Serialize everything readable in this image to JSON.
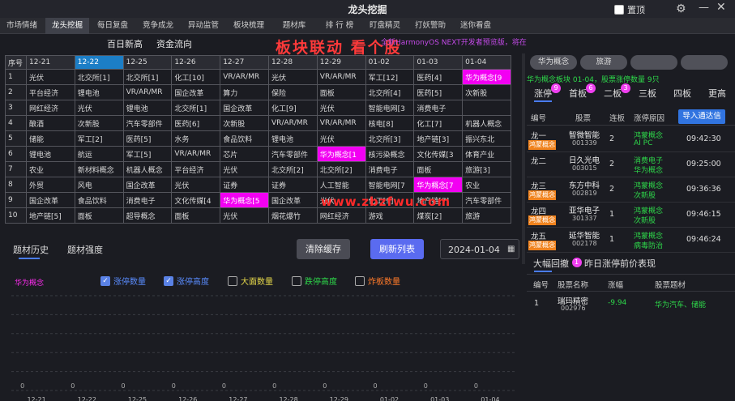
{
  "app": {
    "title": "龙头挖掘",
    "pin_label": "置顶"
  },
  "nav": [
    "市场情绪",
    "龙头挖掘",
    "每日复盘",
    "竞争成龙",
    "异动监管",
    "板块梳理",
    "题材库",
    "排 行 榜",
    "盯盘精灵",
    "打妖警助",
    "迷你看盘"
  ],
  "sub": {
    "tab1": "百日新高",
    "tab2": "资金流向"
  },
  "overlay": {
    "banner": "板块联动  看个股",
    "marquee": "全新HarmonyOS NEXT开发者预览版，将在今年第一季度面向所有开发者开放，鸿蒙异动",
    "watermark": "www.zbzfwu.com"
  },
  "grid": {
    "headers": [
      "序号",
      "12-21",
      "12-22",
      "12-25",
      "12-26",
      "12-27",
      "12-28",
      "12-29",
      "01-02",
      "01-03",
      "01-04"
    ],
    "selected_header": 2,
    "rows": [
      [
        "1",
        "光伏",
        "北交所[1]",
        "北交所[1]",
        "化工[10]",
        "VR/AR/MR",
        "光伏",
        "VR/AR/MR",
        "军工[12]",
        "医药[4]",
        "华为概念[9"
      ],
      [
        "2",
        "平台经济",
        "锂电池",
        "VR/AR/MR",
        "国企改革",
        "算力",
        "保险",
        "面板",
        "北交所[4]",
        "医药[5]",
        "次新股"
      ],
      [
        "3",
        "网红经济",
        "光伏",
        "锂电池",
        "北交所[1]",
        "国企改革",
        "化工[9]",
        "光伏",
        "智能电网[3",
        "消费电子"
      ],
      [
        "4",
        "酿酒",
        "次新股",
        "汽车零部件",
        "医药[6]",
        "次新股",
        "VR/AR/MR",
        "VR/AR/MR",
        "核电[8]",
        "化工[7]",
        "机器人概念"
      ],
      [
        "5",
        "储能",
        "军工[2]",
        "医药[5]",
        "水务",
        "食品饮料",
        "锂电池",
        "光伏",
        "北交所[3]",
        "地产链[3]",
        "振兴东北"
      ],
      [
        "6",
        "锂电池",
        "航运",
        "军工[5]",
        "VR/AR/MR",
        "芯片",
        "汽车零部件",
        "华为概念[1",
        "核污染概念",
        "文化传媒[3",
        "体育产业"
      ],
      [
        "7",
        "农业",
        "新材料概念",
        "机器人概念",
        "平台经济",
        "光伏",
        "北交所[2]",
        "北交所[2]",
        "消费电子",
        "面板",
        "旅游[3]",
        "氢能源"
      ],
      [
        "8",
        "外贸",
        "风电",
        "国企改革",
        "光伏",
        "证券",
        "证券",
        "人工智能",
        "智能电网[7",
        "华为概念[7",
        "农业"
      ],
      [
        "9",
        "国企改革",
        "食品饮料",
        "消费电子",
        "文化传媒[4",
        "华为概念[5",
        "国企改革",
        "光伏",
        "化工[9]",
        "地产链[7]",
        "汽车零部件"
      ],
      [
        "10",
        "地产链[5]",
        "面板",
        "超导概念",
        "面板",
        "光伏",
        "烟花爆竹",
        "网红经济",
        "游戏",
        "煤炭[2]",
        "旅游"
      ]
    ]
  },
  "panel": {
    "tab_history": "题材历史",
    "tab_strength": "题材强度",
    "clear_btn": "清除缓存",
    "refresh_btn": "刷新列表",
    "date": "2024-01-04"
  },
  "chart_data": {
    "type": "bar",
    "series_label": "华为概念",
    "legend": [
      {
        "name": "涨停数量",
        "checked": true,
        "color": "#5a8cff"
      },
      {
        "name": "涨停高度",
        "checked": true,
        "color": "#5a8cff"
      },
      {
        "name": "大面数量",
        "checked": false,
        "color": "#e6d84a"
      },
      {
        "name": "跌停高度",
        "checked": false,
        "color": "#2ed84a"
      },
      {
        "name": "炸板数量",
        "checked": false,
        "color": "#ff7a2a"
      }
    ],
    "categories": [
      "12-21",
      "12-22",
      "12-25",
      "12-26",
      "12-27",
      "12-28",
      "12-29",
      "01-02",
      "01-03",
      "01-04"
    ],
    "values": [
      0,
      0,
      0,
      0,
      0,
      0,
      0,
      0,
      0,
      0
    ],
    "ylim": [
      0,
      10
    ],
    "grid": true
  },
  "right": {
    "buttons": [
      "华为概念",
      "旅游"
    ],
    "info": "华为概念板块 01-04，股票涨停数量 9只",
    "tabs": [
      {
        "label": "涨停",
        "badge": "9"
      },
      {
        "label": "首板",
        "badge": "6"
      },
      {
        "label": "二板",
        "badge": "3"
      },
      {
        "label": "三板"
      },
      {
        "label": "四板"
      },
      {
        "label": "更高"
      }
    ],
    "list_head": {
      "c1": "编号",
      "c2": "股票",
      "c3": "连板",
      "c4": "涨停原因",
      "import_btn": "导入通达信"
    },
    "list": [
      {
        "rank": "龙一",
        "tag": "鸿蒙概念",
        "name": "智微智能",
        "code": "001339",
        "boards": "2",
        "reason1": "鸿蒙概念",
        "reason2": "AI PC",
        "time": "09:42:30"
      },
      {
        "rank": "龙二",
        "tag": "",
        "name": "日久光电",
        "code": "003015",
        "boards": "2",
        "reason1": "消费电子",
        "reason2": "华为概念",
        "time": "09:25:00"
      },
      {
        "rank": "龙三",
        "tag": "鸿蒙概念",
        "name": "东方中科",
        "code": "002819",
        "boards": "2",
        "reason1": "鸿蒙概念",
        "reason2": "次新股",
        "time": "09:36:36"
      },
      {
        "rank": "龙四",
        "tag": "鸿蒙概念",
        "name": "亚华电子",
        "code": "301337",
        "boards": "1",
        "reason1": "鸿蒙概念",
        "reason2": "次新股",
        "time": "09:46:15"
      },
      {
        "rank": "龙五",
        "tag": "鸿蒙概念",
        "name": "延华智能",
        "code": "002178",
        "boards": "1",
        "reason1": "鸿蒙概念",
        "reason2": "病毒防治",
        "time": "09:46:24"
      }
    ],
    "fall": {
      "title1": "大幅回撤",
      "badge": "1",
      "title2": "昨日涨停前价表现",
      "head": [
        "编号",
        "股票名称",
        "涨幅",
        "股票题材"
      ],
      "row": {
        "idx": "1",
        "name": "瑞玛精密",
        "code": "002976",
        "change": "-9.94",
        "theme": "华为汽车、储能"
      }
    }
  }
}
